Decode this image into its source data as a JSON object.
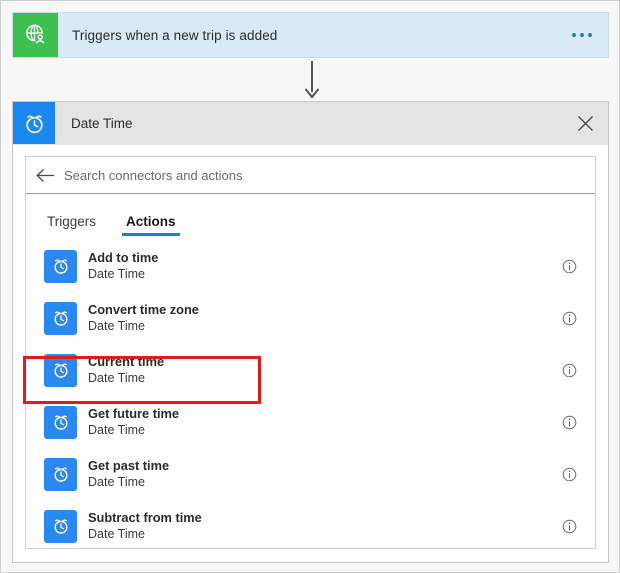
{
  "trigger_card": {
    "icon": "globe-user-icon",
    "icon_bg": "#3fbf4f",
    "title": "Triggers when a new trip is added",
    "overflow_label": "...",
    "background": "#d9eaf7"
  },
  "connector": {
    "icon": "down-arrow-icon"
  },
  "picker": {
    "header": {
      "icon": "alarm-clock-icon",
      "icon_bg": "#1b88f0",
      "title": "Date Time",
      "close_label": "Close",
      "close_icon": "close-icon"
    },
    "search": {
      "back_icon": "back-arrow-icon",
      "placeholder": "Search connectors and actions",
      "value": ""
    },
    "tabs": [
      {
        "label": "Triggers",
        "selected": false
      },
      {
        "label": "Actions",
        "selected": true
      }
    ],
    "accent_color": "#1b7fd4",
    "highlight_color": "#e01b1b",
    "actions": [
      {
        "name": "Add to time",
        "connector": "Date Time",
        "icon": "alarm-clock-icon",
        "info_icon": "info-icon",
        "highlighted": false
      },
      {
        "name": "Convert time zone",
        "connector": "Date Time",
        "icon": "alarm-clock-icon",
        "info_icon": "info-icon",
        "highlighted": false
      },
      {
        "name": "Current time",
        "connector": "Date Time",
        "icon": "alarm-clock-icon",
        "info_icon": "info-icon",
        "highlighted": true
      },
      {
        "name": "Get future time",
        "connector": "Date Time",
        "icon": "alarm-clock-icon",
        "info_icon": "info-icon",
        "highlighted": false
      },
      {
        "name": "Get past time",
        "connector": "Date Time",
        "icon": "alarm-clock-icon",
        "info_icon": "info-icon",
        "highlighted": false
      },
      {
        "name": "Subtract from time",
        "connector": "Date Time",
        "icon": "alarm-clock-icon",
        "info_icon": "info-icon",
        "highlighted": false
      }
    ]
  }
}
